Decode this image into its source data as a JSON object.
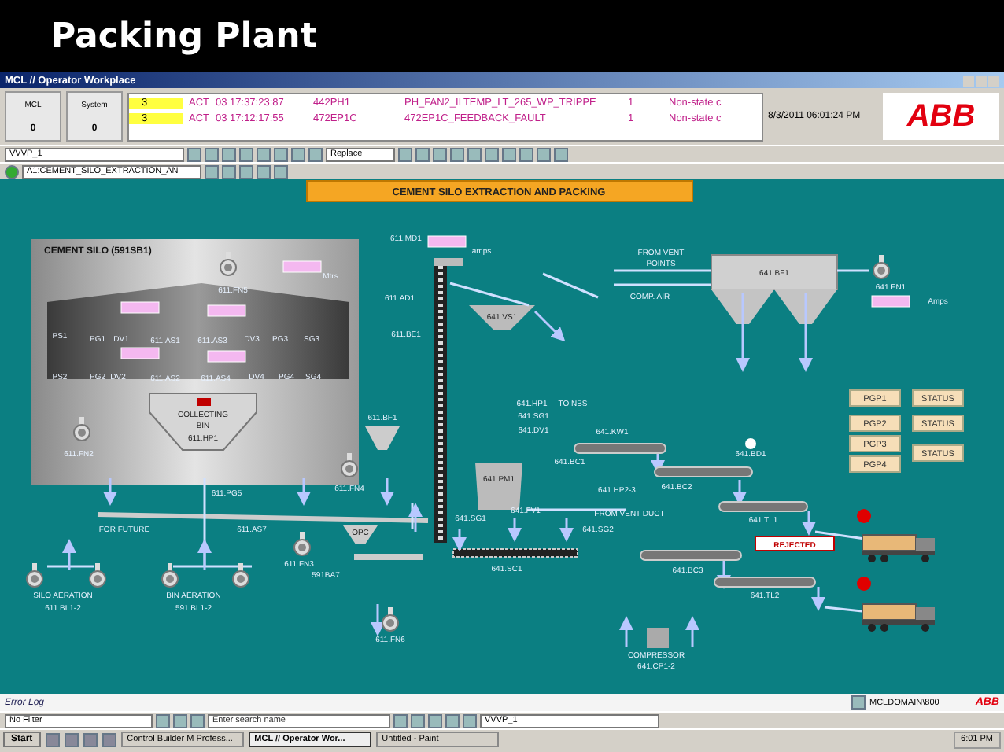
{
  "slide_title": "Packing Plant",
  "window": {
    "title": "MCL // Operator Workplace"
  },
  "counters": [
    {
      "label": "MCL",
      "value": "0"
    },
    {
      "label": "System",
      "value": "0"
    }
  ],
  "alarms": [
    {
      "priority": "3",
      "state": "ACT",
      "time": "03 17:37:23:87",
      "object": "442PH1",
      "description": "PH_FAN2_ILTEMP_LT_265_WP_TRIPPE",
      "value": "1",
      "condition": "Non-state c"
    },
    {
      "priority": "3",
      "state": "ACT",
      "time": "03 17:12:17:55",
      "object": "472EP1C",
      "description": "472EP1C_FEEDBACK_FAULT",
      "value": "1",
      "condition": "Non-state c"
    }
  ],
  "datetime": "8/3/2011 06:01:24 PM",
  "logo": "ABB",
  "toolbar": {
    "workplace": "VVVP_1",
    "mode": "Replace",
    "display_path": "A1:CEMENT_SILO_EXTRACTION_AN"
  },
  "diagram": {
    "title": "CEMENT SILO EXTRACTION AND PACKING",
    "silo_title": "CEMENT SILO (591SB1)",
    "hopper_label": "OPC",
    "rejected": "REJECTED",
    "labels": [
      "611.FN5",
      "Mtrs",
      "PS1",
      "PG1",
      "DV1",
      "611.AS1",
      "611.AS3",
      "DV3",
      "PG3",
      "SG3",
      "PS2",
      "PG2",
      "DV2",
      "611.AS2",
      "611.AS4",
      "DV4",
      "PG4",
      "SG4",
      "COLLECTING",
      "BIN",
      "611.HP1",
      "611.FN2",
      "611.BF1",
      "611.FN4",
      "611.PG5",
      "611.MD1",
      "amps",
      "611.AD1",
      "611.BE1",
      "FROM VENT",
      "POINTS",
      "COMP. AIR",
      "641.BF1",
      "641.FN1",
      "Amps",
      "641.VS1",
      "641.HP1",
      "TO NBS",
      "641.SG1",
      "641.DV1",
      "641.KW1",
      "641.BC1",
      "641.HP2-3",
      "641.PM1",
      "641.BD1",
      "641.BC2",
      "FOR FUTURE",
      "611.AS7",
      "611.FN3",
      "591BA7",
      "SILO AERATION",
      "611.BL1-2",
      "BIN AERATION",
      "591 BL1-2",
      "611.FN6",
      "641.SG1",
      "641.FV1",
      "FROM VENT DUCT",
      "641.SG2",
      "641.SC1",
      "641.TL1",
      "641.BC3",
      "641.TL2",
      "COMPRESSOR",
      "641.CP1-2"
    ],
    "packers": [
      {
        "label": "PGP1"
      },
      {
        "label": "PGP2"
      },
      {
        "label": "PGP3"
      },
      {
        "label": "PGP4"
      }
    ],
    "status_buttons": [
      "STATUS",
      "STATUS",
      "STATUS"
    ]
  },
  "error_log": {
    "title": "Error Log",
    "domain": "MCLDOMAIN\\800",
    "logo": "ABB"
  },
  "filter_bar": {
    "filter": "No Filter",
    "search_placeholder": "Enter search name",
    "workplace": "VVVP_1"
  },
  "taskbar": {
    "start": "Start",
    "tasks": [
      {
        "label": "Control Builder M Profess...",
        "selected": false
      },
      {
        "label": "MCL // Operator Wor...",
        "selected": true
      },
      {
        "label": "Untitled - Paint",
        "selected": false
      }
    ],
    "clock": "6:01 PM"
  }
}
